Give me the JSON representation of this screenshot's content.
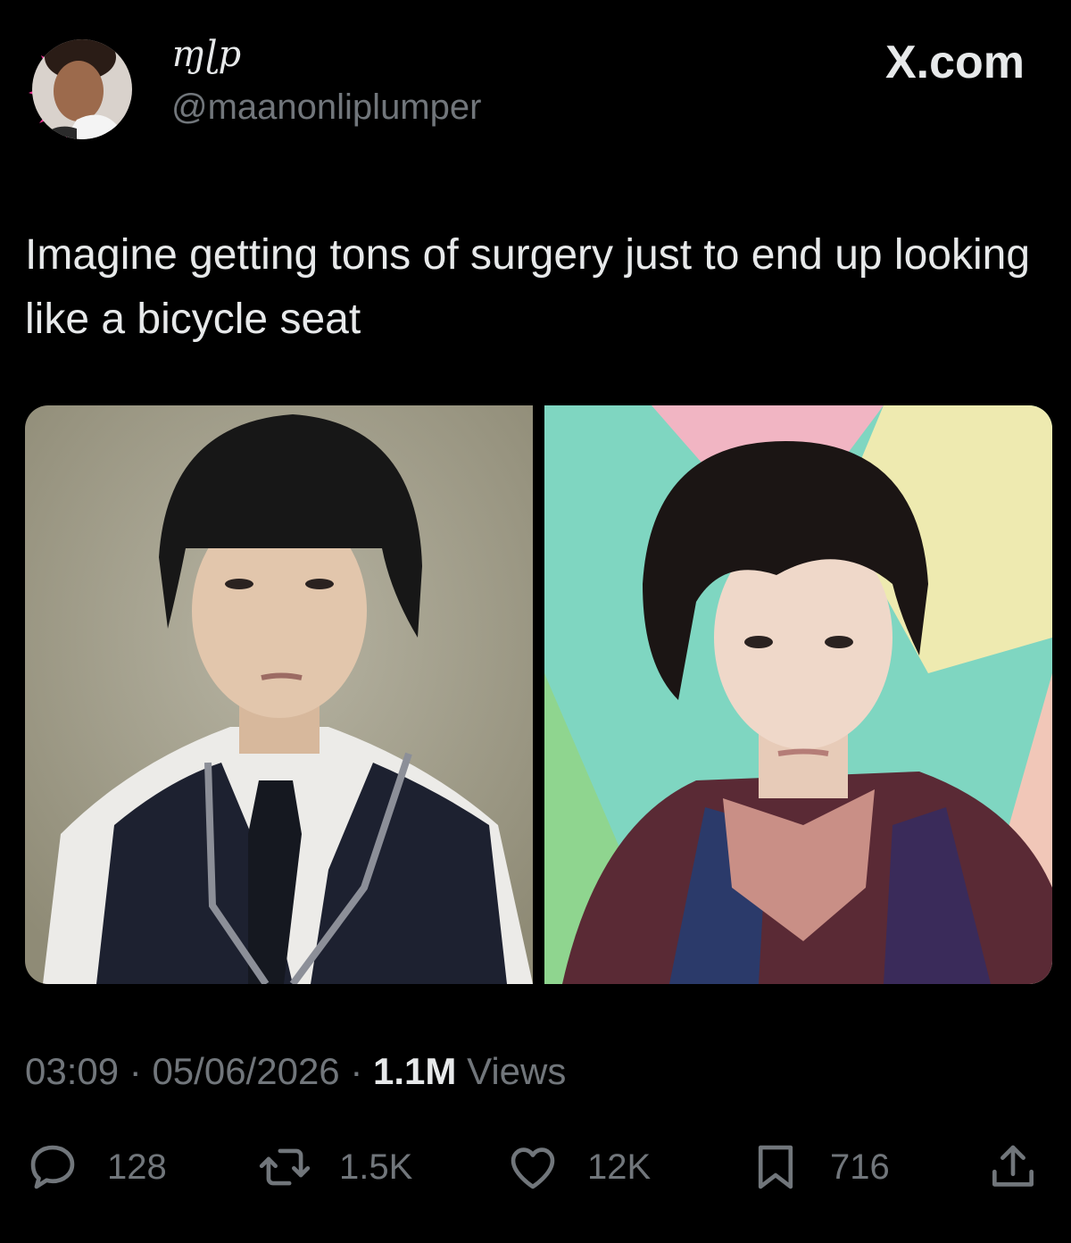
{
  "author": {
    "display_name": "ɱɭp",
    "handle": "@maanonliplumper",
    "avatar": "avatar-photo"
  },
  "brand": {
    "label": "X.com",
    "icon": "x-logo"
  },
  "tweet": {
    "text": "Imagine getting tons of surgery just to end up looking like a bicycle seat"
  },
  "media": {
    "photos": [
      "photo-left",
      "photo-right"
    ]
  },
  "meta": {
    "time": "03:09",
    "separator": "·",
    "date": "05/06/2026",
    "views_count": "1.1M",
    "views_label": "Views"
  },
  "actions": {
    "replies": {
      "icon": "reply-icon",
      "count": "128"
    },
    "reposts": {
      "icon": "retweet-icon",
      "count": "1.5K"
    },
    "likes": {
      "icon": "heart-icon",
      "count": "12K"
    },
    "bookmarks": {
      "icon": "bookmark-icon",
      "count": "716"
    },
    "share": {
      "icon": "share-icon"
    }
  },
  "colors": {
    "background": "#000000",
    "text": "#e7e9ea",
    "muted": "#71767b",
    "avatar_accent": "#e6308f"
  }
}
